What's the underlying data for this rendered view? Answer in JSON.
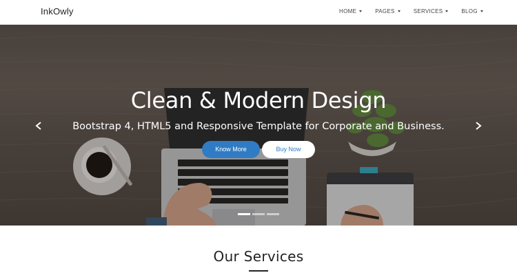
{
  "navbar": {
    "brand": "InkOwly",
    "items": [
      {
        "label": "HOME"
      },
      {
        "label": "PAGES"
      },
      {
        "label": "SERVICES"
      },
      {
        "label": "BLOG"
      }
    ]
  },
  "hero": {
    "title": "Clean & Modern Design",
    "subtitle": "Bootstrap 4, HTML5 and Responsive Template for Corporate and Business.",
    "primary_button": "Know More",
    "secondary_button": "Buy Now",
    "slide_count": 3,
    "active_slide": 1
  },
  "services": {
    "title": "Our Services"
  },
  "colors": {
    "accent": "#2f7cc4",
    "navbar_bg": "#ffffff",
    "hero_overlay": "#141210"
  }
}
